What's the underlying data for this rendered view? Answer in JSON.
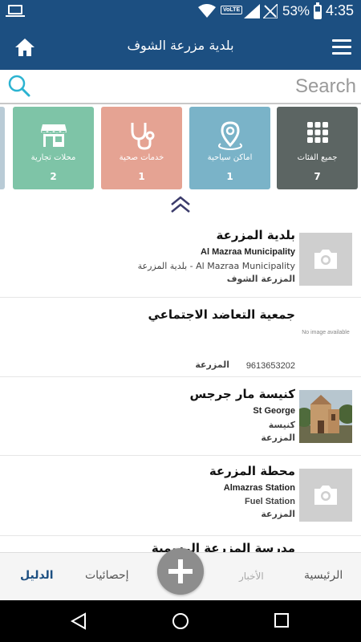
{
  "status_bar": {
    "volte": "VoLTE",
    "battery_percent": "53%",
    "battery_level": 0.53,
    "time": "4:35"
  },
  "header": {
    "title": "بلدية مزرعة الشوف",
    "home_icon": "home-icon",
    "menu_icon": "hamburger-menu-icon",
    "color": "#1c4f81"
  },
  "search": {
    "placeholder": "Search",
    "value": ""
  },
  "categories": [
    {
      "label": "جميع الفئات",
      "count": "7",
      "color": "#5c6563",
      "icon": "grid-icon"
    },
    {
      "label": "اماكن سياحية",
      "count": "1",
      "color": "#7ab3c8",
      "icon": "map-pin-icon"
    },
    {
      "label": "خدمات صحية",
      "count": "1",
      "color": "#e5a393",
      "icon": "stethoscope-icon"
    },
    {
      "label": "محلات تجارية",
      "count": "2",
      "color": "#7ec4a7",
      "icon": "store-icon"
    }
  ],
  "listings": [
    {
      "title": "بلدية المزرعة",
      "subtitle": "Al Mazraa Municipality",
      "subtitle2": "بلدية المزرعة - Al Mazraa Municipality",
      "place": "المزرعة الشوف",
      "image": "camera-placeholder"
    },
    {
      "title": "جمعية التعاضد الاجتماعي",
      "no_image": "No image available",
      "phone": "9613653202",
      "place": "المزرعة",
      "image": "no-image"
    },
    {
      "title": "كنيسة مار جرجس",
      "subtitle": "St George",
      "subtitle2": "كنيسة",
      "place": "المزرعة",
      "image": "church-photo"
    },
    {
      "title": "محطة المزرعة",
      "subtitle": "Almazras Station",
      "subtitle2": "Fuel Station",
      "place": "المزرعة",
      "image": "camera-placeholder"
    },
    {
      "title": "مدرسة المزرعة الرسمية",
      "image": "camera-placeholder"
    }
  ],
  "bottom_nav": {
    "directory": "الدليل",
    "statistics": "إحصائيات",
    "news": "الأخبار",
    "home": "الرئيسية"
  }
}
